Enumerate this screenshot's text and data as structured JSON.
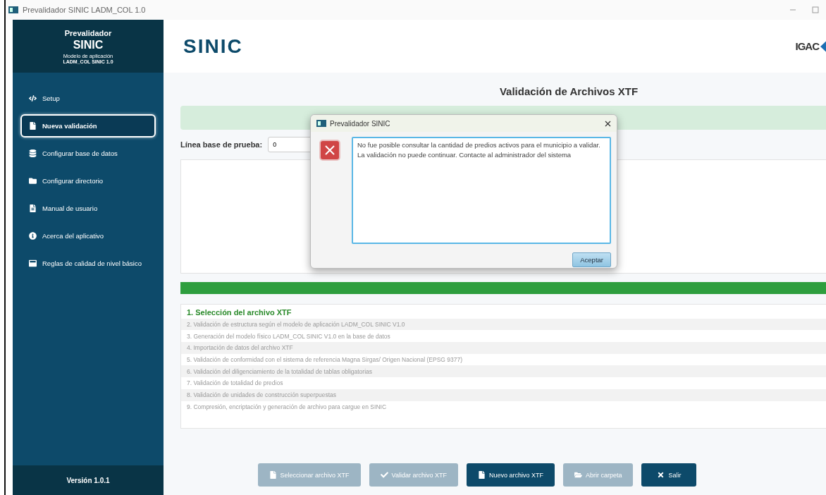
{
  "window": {
    "title": "Prevalidador SINIC LADM_COL 1.0"
  },
  "sidebar": {
    "app_label": "Prevalidador",
    "app_name": "SINIC",
    "subtitle": "Modelo de aplicación",
    "model": "LADM_COL SINIC 1.0",
    "items": [
      {
        "label": "Setup",
        "selected": false
      },
      {
        "label": "Nueva validación",
        "selected": true
      },
      {
        "label": "Configurar base de datos",
        "selected": false
      },
      {
        "label": "Configurar directorio",
        "selected": false
      },
      {
        "label": "Manual de usuario",
        "selected": false
      },
      {
        "label": "Acerca del aplicativo",
        "selected": false
      },
      {
        "label": "Reglas de calidad de nivel básico",
        "selected": false
      }
    ],
    "version": "Versión 1.0.1"
  },
  "header": {
    "logo": "SINIC",
    "partner_logo": "IGAC"
  },
  "page": {
    "title": "Validación de Archivos XTF",
    "baseline_label": "Línea base de prueba:",
    "baseline_value": "0",
    "progress": {
      "level": 1.0
    },
    "steps": [
      {
        "label": "1. Selección del archivo XTF",
        "active": true
      },
      {
        "label": "2. Validación de estructura según el modelo de aplicación LADM_COL SINIC V1.0",
        "active": false
      },
      {
        "label": "3. Generación del modelo físico LADM_COL SINIC V1.0 en la base de datos",
        "active": false
      },
      {
        "label": "4. Importación de datos del archivo XTF",
        "active": false
      },
      {
        "label": "5. Validación de conformidad con el sistema de referencia Magna Sirgas/ Origen Nacional (EPSG 9377)",
        "active": false
      },
      {
        "label": "6. Validación del diligenciamiento de la totalidad de tablas obligatorias",
        "active": false
      },
      {
        "label": "7. Validación de totalidad de predios",
        "active": false
      },
      {
        "label": "8. Validación de unidades de construcción superpuestas",
        "active": false
      },
      {
        "label": "9. Compresión, encriptación y generación de archivo para cargue en SINIC",
        "active": false
      }
    ],
    "buttons": [
      {
        "label": "Seleccionar archivo XTF",
        "disabled": true
      },
      {
        "label": "Validar archivo XTF",
        "disabled": true
      },
      {
        "label": "Nuevo archivo XTF",
        "disabled": false
      },
      {
        "label": "Abrir carpeta",
        "disabled": true
      },
      {
        "label": "Salir",
        "disabled": false
      }
    ]
  },
  "dialog": {
    "title": "Prevalidador SINIC",
    "message": "No fue posible consultar la cantidad de predios activos para el municipio a validar. La validación no puede continuar. Contacte al administrador del sistema",
    "button": "Aceptar"
  }
}
